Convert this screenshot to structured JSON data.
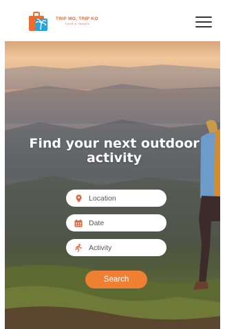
{
  "header": {
    "logo_title": "TRIP MO, TRIP KO",
    "logo_subtitle": "TOUR & TRAVEL",
    "logo_icon": "suitcase-palm-logo",
    "menu_icon": "hamburger-menu-icon"
  },
  "hero": {
    "headline_line1": "Find your next outdoor",
    "headline_line2": "activity",
    "background": "mountain-hiker-photo"
  },
  "search": {
    "location_placeholder": "Location",
    "location_icon": "map-pin-icon",
    "date_placeholder": "Date",
    "date_icon": "calendar-icon",
    "activity_placeholder": "Activity",
    "activity_icon": "running-person-icon",
    "button_label": "Search"
  },
  "colors": {
    "accent": "#ef7f32",
    "brand": "#e8623a",
    "icon": "#e8623a"
  }
}
